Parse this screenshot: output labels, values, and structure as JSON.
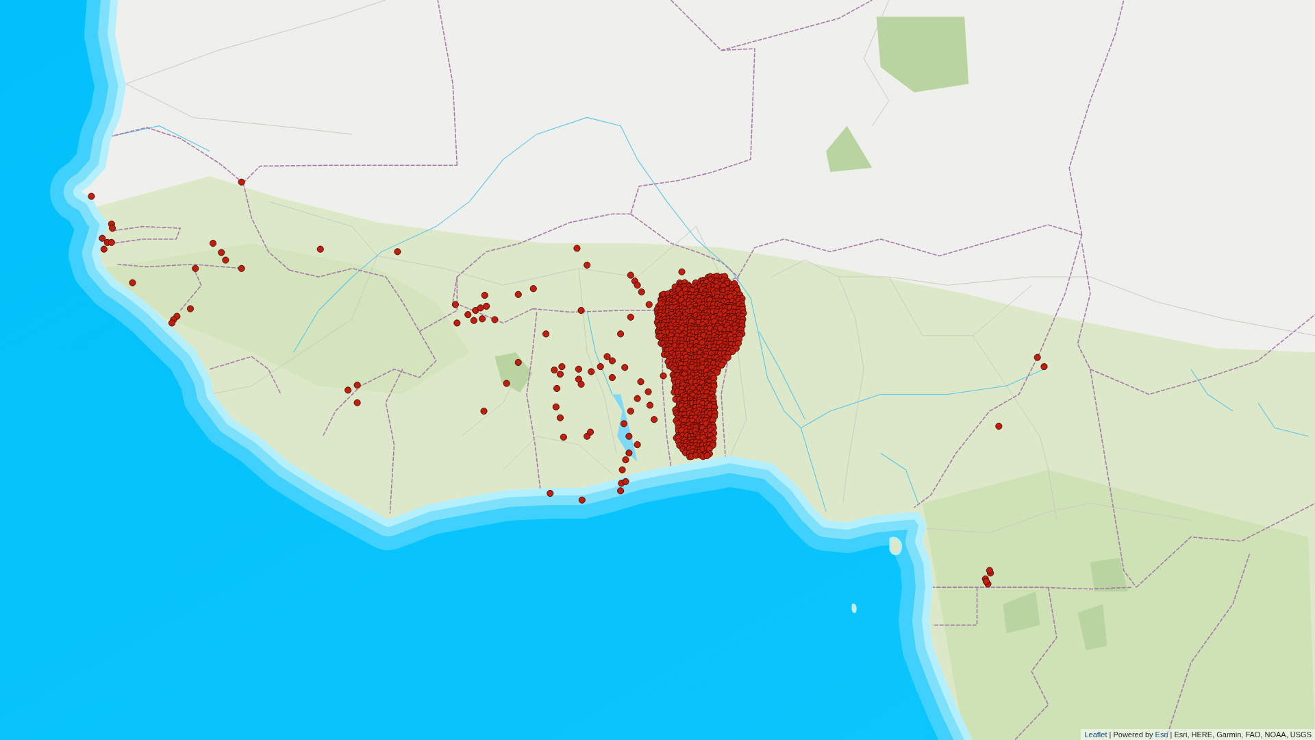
{
  "map": {
    "attribution": [
      {
        "kind": "link",
        "text": "Leaflet"
      },
      {
        "kind": "separator",
        "text": "|"
      },
      {
        "kind": "text",
        "text": "Powered by"
      },
      {
        "kind": "link",
        "text": "Esri"
      },
      {
        "kind": "separator",
        "text": "|"
      },
      {
        "kind": "text",
        "text": "Esri, HERE, Garmin, FAO, NOAA, USGS"
      }
    ]
  }
}
